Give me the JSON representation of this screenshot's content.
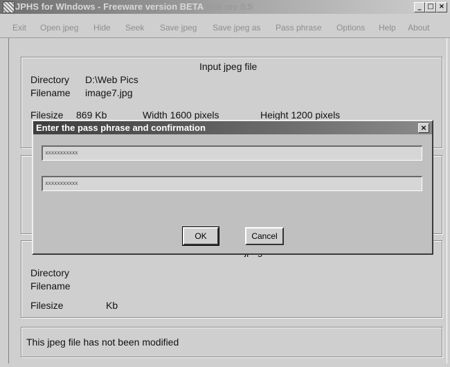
{
  "window": {
    "title_main": "JPHS for WIndows - Freeware version BETA ",
    "title_rest": "test rev 0.5",
    "controls": [
      "_",
      "□",
      "×"
    ]
  },
  "menu": [
    "Exit",
    "Open jpeg",
    "Hide",
    "Seek",
    "Save jpeg",
    "Save jpeg as",
    "Pass phrase",
    "Options",
    "Help",
    "About"
  ],
  "input_group": {
    "heading": "Input jpeg file",
    "directory_label": "Directory",
    "directory_value": "D:\\Web Pics",
    "filename_label": "Filename",
    "filename_value": "image7.jpg",
    "filesize_label": "Filesize",
    "filesize_value": "869 Kb",
    "width_text": "Width 1600  pixels",
    "height_text": "Height 1200  pixels"
  },
  "output_group": {
    "heading_partial": "jpeg",
    "directory_label": "Directory",
    "filename_label": "Filename",
    "filesize_label": "Filesize",
    "filesize_unit": "Kb"
  },
  "status": {
    "text": "This jpeg file has not been modified"
  },
  "dialog": {
    "title": "Enter the pass phrase and confirmation",
    "close": "×",
    "pass_value": "xxxxxxxxxxx",
    "confirm_value": "xxxxxxxxxxx",
    "ok_label": "OK",
    "cancel_label": "Cancel"
  }
}
